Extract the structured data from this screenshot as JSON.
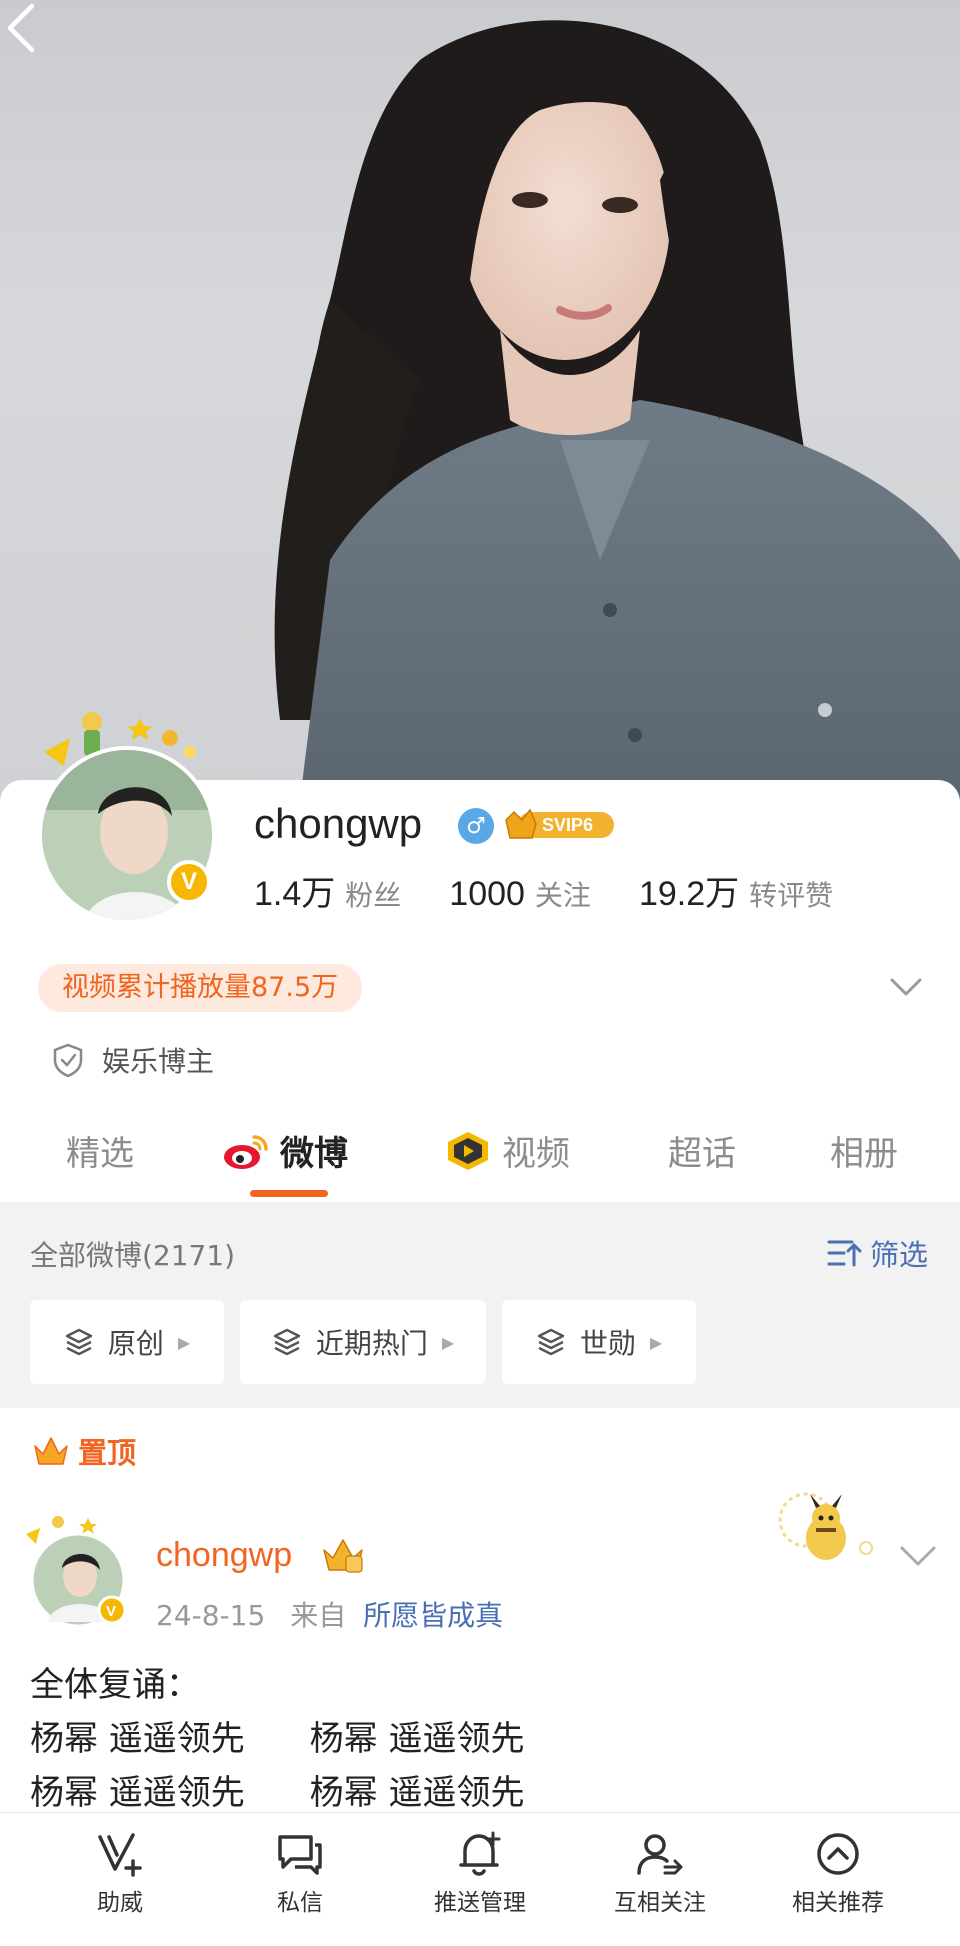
{
  "profile": {
    "username": "chongwp",
    "gender_symbol": "♂",
    "vip_label": "SVIP6",
    "verified_mark": "V",
    "stats": [
      {
        "value": "1.4万",
        "label": "粉丝"
      },
      {
        "value": "1000",
        "label": "关注"
      },
      {
        "value": "19.2万",
        "label": "转评赞"
      }
    ],
    "play_count": "视频累计播放量87.5万",
    "tag": "娱乐博主"
  },
  "tabs": [
    {
      "label": "精选"
    },
    {
      "label": "微博"
    },
    {
      "label": "视频"
    },
    {
      "label": "超话"
    },
    {
      "label": "相册"
    }
  ],
  "feed": {
    "all_count": "全部微博(2171)",
    "filter_label": "筛选",
    "chips": [
      "原创",
      "近期热门",
      "世勋"
    ]
  },
  "post": {
    "pinned_label": "置顶",
    "author": "chongwp",
    "date": "24-8-15",
    "from_label": "来自",
    "source": "所愿皆成真",
    "lines": [
      "全体复诵：",
      "杨幂 遥遥领先      杨幂 遥遥领先",
      "杨幂 遥遥领先      杨幂 遥遥领先"
    ]
  },
  "bottom_bar": [
    "助威",
    "私信",
    "推送管理",
    "互相关注",
    "相关推荐"
  ],
  "colors": {
    "accent": "#f26420",
    "link": "#4a6fb3",
    "gold": "#f5b700"
  }
}
